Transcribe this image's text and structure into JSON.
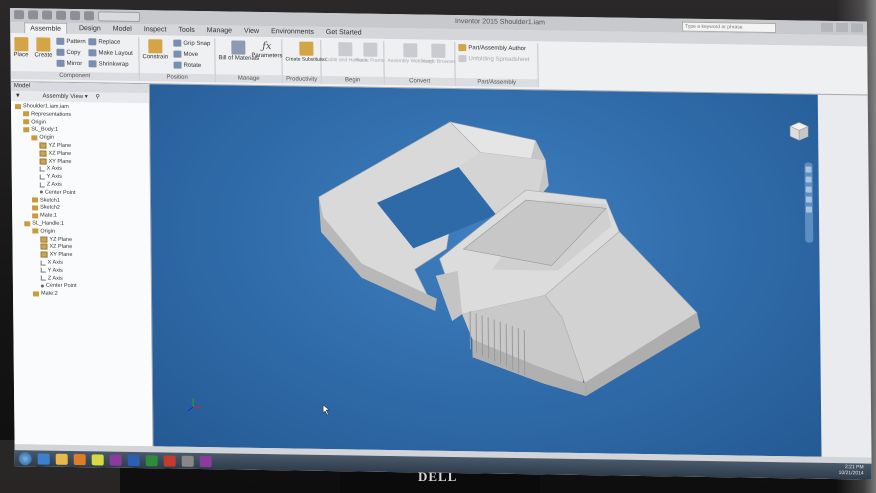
{
  "titlebar": {
    "document_title": "Inventor 2015   Shoulder1.iam",
    "search_placeholder": "Type a keyword or phrase"
  },
  "tabs": [
    "Assemble",
    "Design",
    "Model",
    "Inspect",
    "Tools",
    "Manage",
    "View",
    "Environments",
    "Get Started"
  ],
  "ribbon": {
    "component": {
      "label": "Component",
      "place": "Place",
      "create": "Create",
      "pattern": "Pattern",
      "copy": "Copy",
      "mirror": "Mirror",
      "replace": "Replace",
      "make_layout": "Make Layout",
      "shrinkwrap": "Shrinkwrap"
    },
    "position": {
      "label": "Position",
      "constrain": "Constrain",
      "grip_snap": "Grip Snap",
      "move": "Move",
      "rotate": "Rotate"
    },
    "manage": {
      "label": "Manage",
      "bill_of_materials": "Bill of Materials",
      "parameters": "Parameters"
    },
    "productivity": {
      "label": "Productivity",
      "create_substitutes": "Create Substitutes"
    },
    "begin": {
      "label": "Begin",
      "cable_harness": "Cable and Harness",
      "route_frame": "Route Frame"
    },
    "convert": {
      "label": "Convert",
      "assembly_weldment": "Assembly Weldment",
      "ilogic": "iLogic Browser"
    },
    "author": {
      "label": "Part/Assembly",
      "author_label": "Part/Assembly Author",
      "unfolding": "Unfolding Spreadsheet"
    }
  },
  "browser": {
    "title": "Model",
    "view_mode": "Assembly View",
    "tree": [
      {
        "label": "Shoulder1.iam.iam",
        "indent": 0,
        "icon": "assembly"
      },
      {
        "label": "Representations",
        "indent": 1,
        "icon": "folder"
      },
      {
        "label": "Origin",
        "indent": 1,
        "icon": "folder"
      },
      {
        "label": "SL_Body:1",
        "indent": 1,
        "icon": "part"
      },
      {
        "label": "Origin",
        "indent": 2,
        "icon": "folder"
      },
      {
        "label": "YZ Plane",
        "indent": 3,
        "icon": "plane"
      },
      {
        "label": "XZ Plane",
        "indent": 3,
        "icon": "plane"
      },
      {
        "label": "XY Plane",
        "indent": 3,
        "icon": "plane"
      },
      {
        "label": "X Axis",
        "indent": 3,
        "icon": "axis"
      },
      {
        "label": "Y Axis",
        "indent": 3,
        "icon": "axis"
      },
      {
        "label": "Z Axis",
        "indent": 3,
        "icon": "axis"
      },
      {
        "label": "Center Point",
        "indent": 3,
        "icon": "point"
      },
      {
        "label": "Sketch1",
        "indent": 2,
        "icon": "sketch"
      },
      {
        "label": "Sketch2",
        "indent": 2,
        "icon": "sketch"
      },
      {
        "label": "Mate:1",
        "indent": 2,
        "icon": "sketch"
      },
      {
        "label": "SL_Handle:1",
        "indent": 1,
        "icon": "part"
      },
      {
        "label": "Origin",
        "indent": 2,
        "icon": "folder"
      },
      {
        "label": "YZ Plane",
        "indent": 3,
        "icon": "plane"
      },
      {
        "label": "XZ Plane",
        "indent": 3,
        "icon": "plane"
      },
      {
        "label": "XY Plane",
        "indent": 3,
        "icon": "plane"
      },
      {
        "label": "X Axis",
        "indent": 3,
        "icon": "axis"
      },
      {
        "label": "Y Axis",
        "indent": 3,
        "icon": "axis"
      },
      {
        "label": "Z Axis",
        "indent": 3,
        "icon": "axis"
      },
      {
        "label": "Center Point",
        "indent": 3,
        "icon": "point"
      },
      {
        "label": "Mate:2",
        "indent": 2,
        "icon": "sketch"
      }
    ]
  },
  "viewport": {
    "background_color": "#2f6aa8",
    "part_color": "#d6d6d6"
  },
  "taskbar": {
    "icons": [
      {
        "name": "ie-icon",
        "color": "#3b7fd1"
      },
      {
        "name": "explorer-icon",
        "color": "#e8b84a"
      },
      {
        "name": "media-icon",
        "color": "#e07b2a"
      },
      {
        "name": "chrome-icon",
        "color": "#d8d840"
      },
      {
        "name": "onenote-icon",
        "color": "#8a3b9c"
      },
      {
        "name": "word-icon",
        "color": "#2b5fb3"
      },
      {
        "name": "excel-icon",
        "color": "#2e8a3c"
      },
      {
        "name": "inventor-icon",
        "color": "#c23b2b"
      },
      {
        "name": "app-icon",
        "color": "#888888"
      },
      {
        "name": "onenote2-icon",
        "color": "#8a3b9c"
      }
    ],
    "time": "2:21 PM",
    "date": "10/21/2014"
  },
  "monitor": {
    "brand": "DELL"
  }
}
